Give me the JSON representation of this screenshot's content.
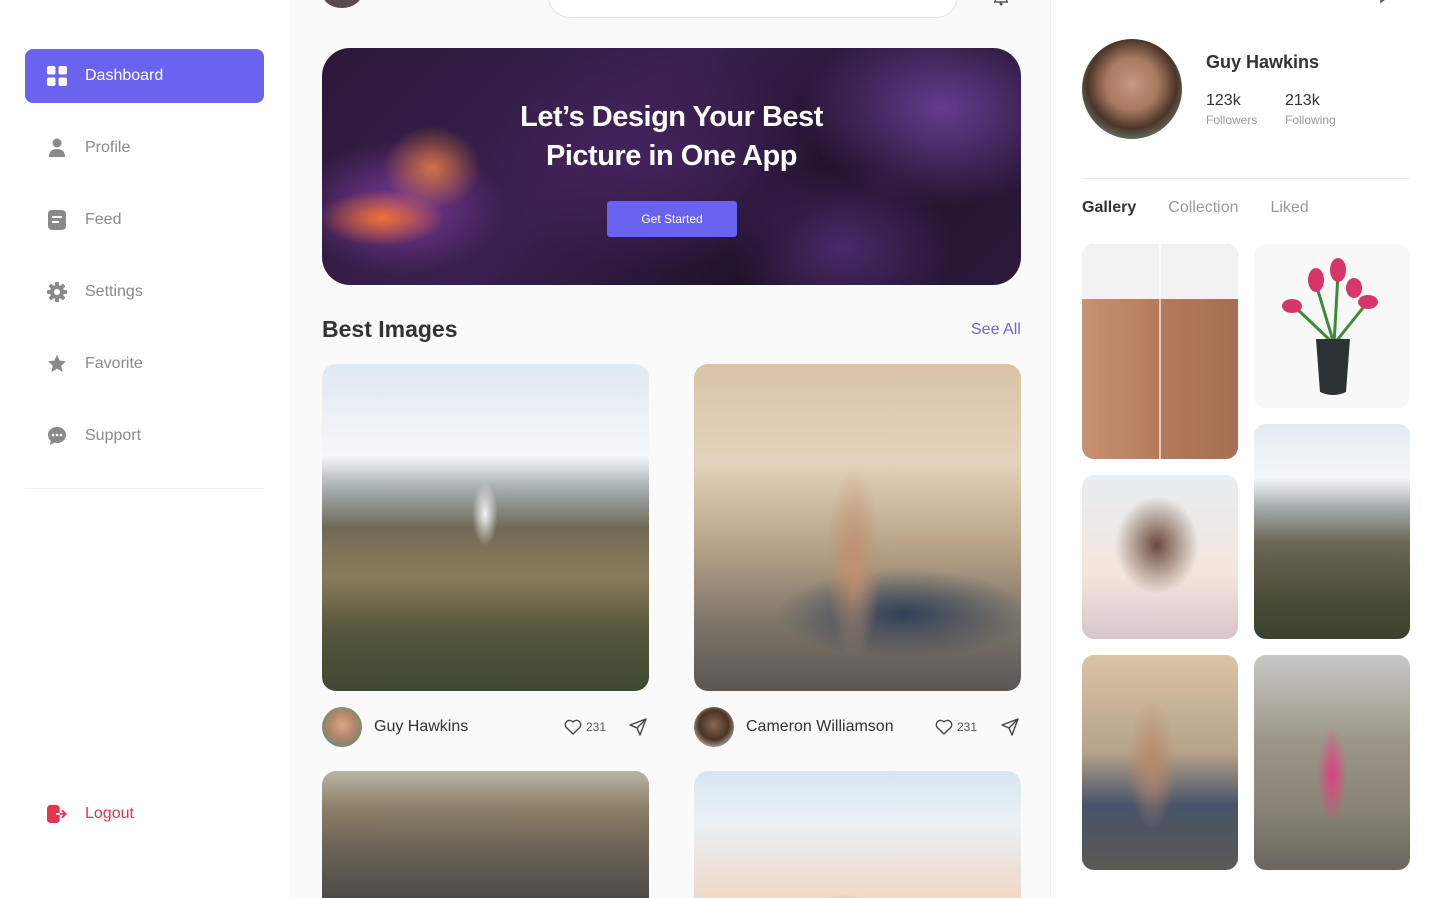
{
  "sidebar": {
    "items": [
      {
        "label": "Dashboard",
        "icon": "dashboard-icon",
        "active": true
      },
      {
        "label": "Profile",
        "icon": "user-icon"
      },
      {
        "label": "Feed",
        "icon": "feed-icon"
      },
      {
        "label": "Settings",
        "icon": "gear-icon"
      },
      {
        "label": "Favorite",
        "icon": "star-icon"
      },
      {
        "label": "Support",
        "icon": "chat-bubble-icon"
      }
    ],
    "logout_label": "Logout"
  },
  "hero": {
    "line1": "Let’s Design Your Best",
    "line2": "Picture in One App",
    "button_label": "Get Started"
  },
  "best_images": {
    "title": "Best Images",
    "see_all": "See All",
    "cards": [
      {
        "author": "Guy Hawkins",
        "likes": "231",
        "image": "astronaut on hillside"
      },
      {
        "author": "Cameron Williamson",
        "likes": "231",
        "image": "woman beside vintage car"
      },
      {
        "image": "crowd on street"
      },
      {
        "image": "woman with glasses"
      }
    ]
  },
  "profile": {
    "name": "Guy Hawkins",
    "followers_value": "123k",
    "followers_label": "Followers",
    "following_value": "213k",
    "following_label": "Following"
  },
  "gallery_tabs": [
    "Gallery",
    "Collection",
    "Liked"
  ],
  "colors": {
    "accent": "#6a63f0",
    "logout": "#e8344e"
  }
}
